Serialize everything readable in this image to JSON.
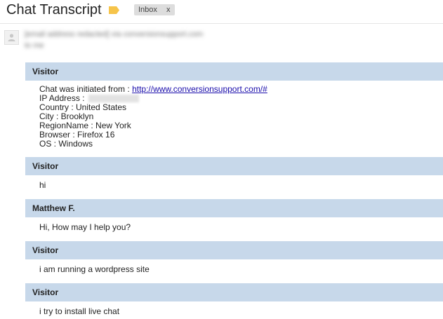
{
  "header": {
    "title": "Chat Transcript",
    "label_chip": "Inbox",
    "label_remove": "x"
  },
  "colors": {
    "message_header_bg": "#c7d8ea",
    "tag_icon": "#f6c44a",
    "link": "#1a0dab"
  },
  "sender": {
    "blurred_line_1": "[email address redacted] via conversionsupport.com",
    "blurred_line_2": "to me"
  },
  "messages": [
    {
      "speaker": "Visitor",
      "info": {
        "initiated_label": "Chat was initiated from : ",
        "initiated_url": "http://www.conversionsupport.com/#",
        "ip_label": "IP Address : ",
        "country": "Country : United States",
        "city": "City : Brooklyn",
        "region": "RegionName : New York",
        "browser": "Browser : Firefox 16",
        "os": "OS : Windows"
      }
    },
    {
      "speaker": "Visitor",
      "text": "hi"
    },
    {
      "speaker": "Matthew F.",
      "text": "Hi, How may I help you?"
    },
    {
      "speaker": "Visitor",
      "text": "i am running a wordpress site"
    },
    {
      "speaker": "Visitor",
      "text": "i try to install live chat"
    }
  ]
}
